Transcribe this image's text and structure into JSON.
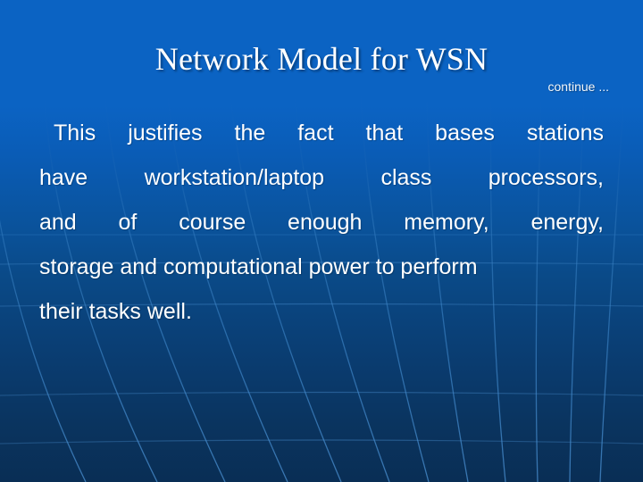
{
  "slide": {
    "title": "Network Model for WSN",
    "continue_label": "continue ...",
    "body_lines": [
      "This justifies the fact that bases stations",
      "have workstation/laptop class processors,",
      "and of course enough memory, energy,",
      "storage and computational power to perform",
      "their tasks well."
    ],
    "full_text": "This justifies the fact that bases stations have workstation/laptop class processors, and of course enough memory, energy, storage and computational power to perform their tasks well."
  },
  "theme": {
    "background_top": "#0b63c3",
    "background_bottom": "#092e55",
    "meridian_line": "#2a6fb5",
    "latitude_line": "#1f5e9e",
    "text_color": "#ffffff"
  }
}
